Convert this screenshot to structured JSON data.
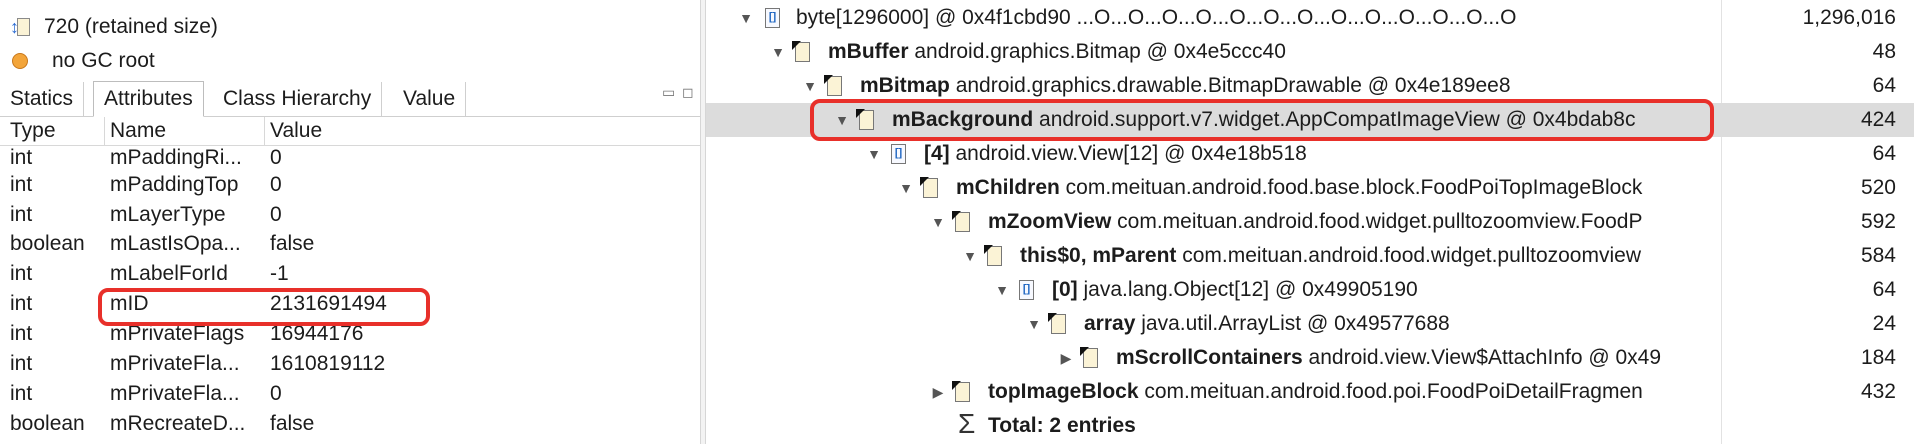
{
  "object_info": {
    "retained_size": "720 (retained size)",
    "gc_root": "no GC root"
  },
  "tabs": [
    "Statics",
    "Attributes",
    "Class Hierarchy",
    "Value"
  ],
  "active_tab": "Attributes",
  "view_controls": {
    "minimize": "▭",
    "maximize": "◻"
  },
  "attributes_table": {
    "columns": [
      "Type",
      "Name",
      "Value"
    ],
    "rows": [
      {
        "type": "int",
        "name": "mPaddingRi...",
        "value": "0"
      },
      {
        "type": "int",
        "name": "mPaddingTop",
        "value": "0"
      },
      {
        "type": "int",
        "name": "mLayerType",
        "value": "0"
      },
      {
        "type": "boolean",
        "name": "mLastIsOpa...",
        "value": "false"
      },
      {
        "type": "int",
        "name": "mLabelForId",
        "value": "-1"
      },
      {
        "type": "int",
        "name": "mID",
        "value": "2131691494"
      },
      {
        "type": "int",
        "name": "mPrivateFlags",
        "value": "16944176"
      },
      {
        "type": "int",
        "name": "mPrivateFla...",
        "value": "1610819112"
      },
      {
        "type": "int",
        "name": "mPrivateFla...",
        "value": "0"
      },
      {
        "type": "boolean",
        "name": "mRecreateD...",
        "value": "false"
      }
    ]
  },
  "reference_tree": [
    {
      "toggle": "▼",
      "icon": "array",
      "field": "",
      "label": "byte[1296000] @ 0x4f1cbd90  ...O...O...O...O...O...O...O...O...O...O...O...O...O",
      "shallow": "1,296,016"
    },
    {
      "toggle": "▼",
      "icon": "object",
      "field": "mBuffer",
      "label": " android.graphics.Bitmap @ 0x4e5ccc40",
      "shallow": "48"
    },
    {
      "toggle": "▼",
      "icon": "object",
      "field": "mBitmap",
      "label": " android.graphics.drawable.BitmapDrawable @ 0x4e189ee8",
      "shallow": "64"
    },
    {
      "toggle": "▼",
      "icon": "object",
      "field": "mBackground",
      "label": " android.support.v7.widget.AppCompatImageView @ 0x4bdab8c",
      "shallow": "424"
    },
    {
      "toggle": "▼",
      "icon": "array",
      "field": "[4]",
      "label": " android.view.View[12] @ 0x4e18b518",
      "shallow": "64"
    },
    {
      "toggle": "▼",
      "icon": "object",
      "field": "mChildren",
      "label": " com.meituan.android.food.base.block.FoodPoiTopImageBlock",
      "shallow": "520"
    },
    {
      "toggle": "▼",
      "icon": "object",
      "field": "mZoomView",
      "label": " com.meituan.android.food.widget.pulltozoomview.FoodP",
      "shallow": "592"
    },
    {
      "toggle": "▼",
      "icon": "object",
      "field": "this$0, mParent",
      "label": " com.meituan.android.food.widget.pulltozoomview",
      "shallow": "584"
    },
    {
      "toggle": "▼",
      "icon": "array",
      "field": "[0]",
      "label": " java.lang.Object[12] @ 0x49905190",
      "shallow": "64"
    },
    {
      "toggle": "▼",
      "icon": "object",
      "field": "array",
      "label": " java.util.ArrayList @ 0x49577688",
      "shallow": "24"
    },
    {
      "toggle": "▶",
      "icon": "object",
      "field": "mScrollContainers",
      "label": " android.view.View$AttachInfo @ 0x49",
      "shallow": "184"
    },
    {
      "toggle": "▶",
      "icon": "object",
      "field": "topImageBlock",
      "label": " com.meituan.android.food.poi.FoodPoiDetailFragmen",
      "shallow": "432"
    }
  ],
  "total": {
    "symbol": "Σ",
    "text": "Total: 2 entries"
  }
}
